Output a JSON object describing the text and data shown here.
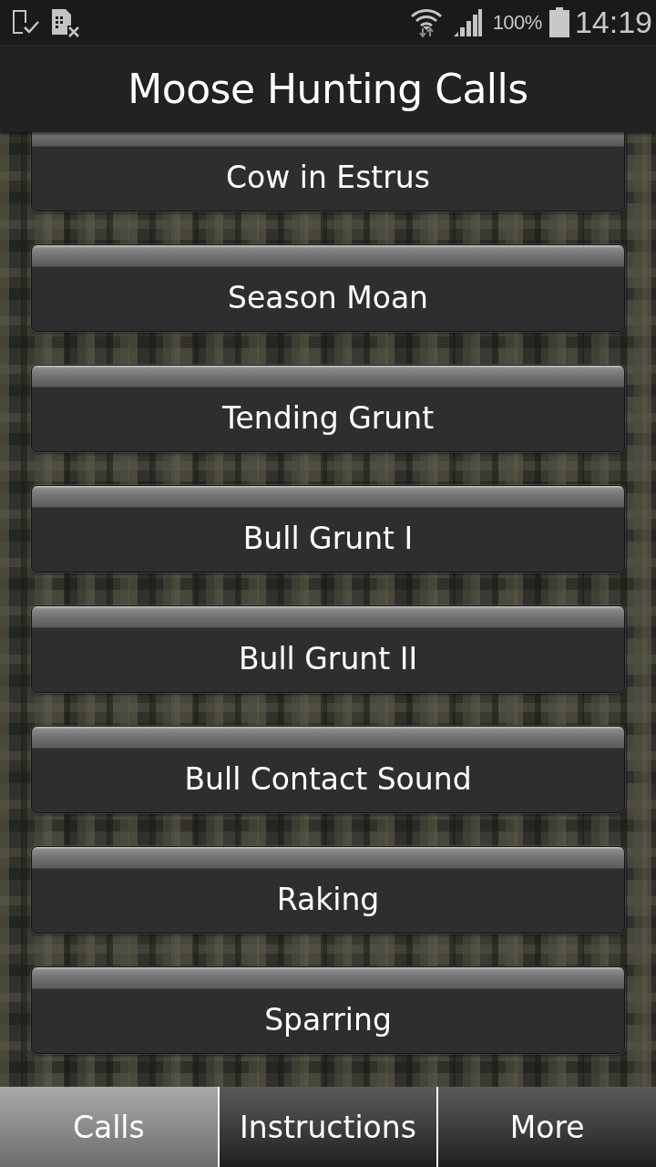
{
  "status_bar": {
    "battery": "100%",
    "time": "14:19"
  },
  "title": "Moose Hunting Calls",
  "calls": [
    {
      "label": "Cow in Estrus"
    },
    {
      "label": "Season Moan"
    },
    {
      "label": "Tending Grunt"
    },
    {
      "label": "Bull Grunt I"
    },
    {
      "label": "Bull Grunt II"
    },
    {
      "label": "Bull Contact Sound"
    },
    {
      "label": "Raking"
    },
    {
      "label": "Sparring"
    }
  ],
  "tabs": [
    {
      "label": "Calls",
      "selected": true
    },
    {
      "label": "Instructions",
      "selected": false
    },
    {
      "label": "More",
      "selected": false
    }
  ]
}
